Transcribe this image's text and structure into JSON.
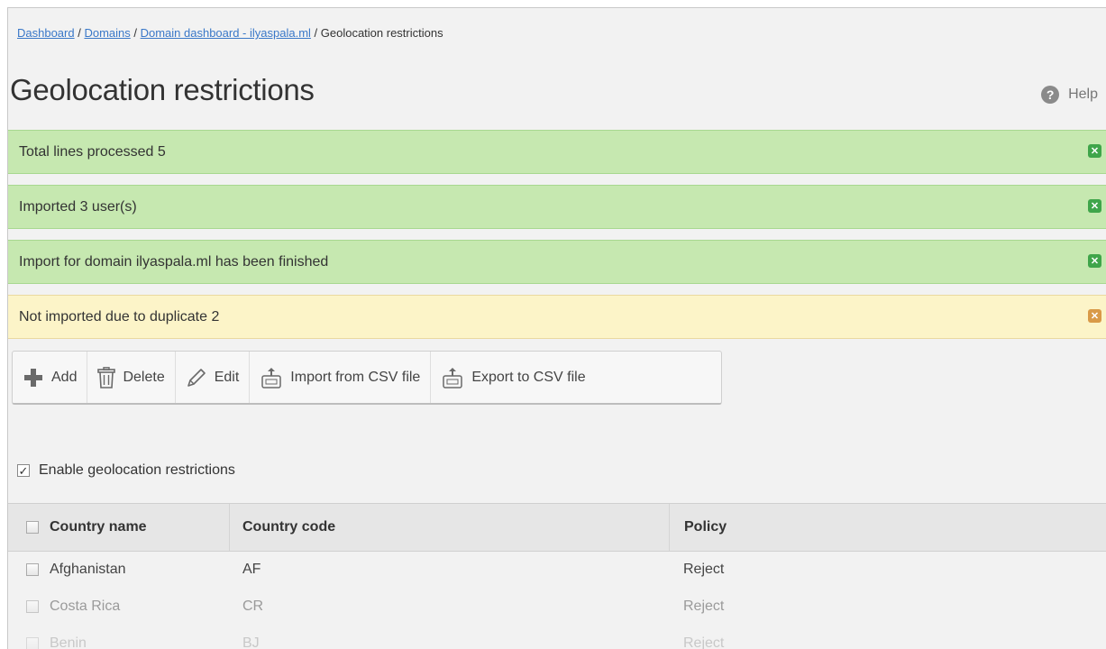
{
  "breadcrumb": {
    "items": [
      "Dashboard",
      "Domains",
      "Domain dashboard - ilyaspala.ml"
    ],
    "separator": " / ",
    "current": "Geolocation restrictions"
  },
  "page": {
    "title": "Geolocation restrictions",
    "help_label": "Help"
  },
  "alerts": [
    {
      "text": "Total lines processed 5",
      "type": "success"
    },
    {
      "text": "Imported 3 user(s)",
      "type": "success"
    },
    {
      "text": "Import for domain ilyaspala.ml has been finished",
      "type": "success"
    },
    {
      "text": "Not imported due to duplicate 2",
      "type": "warning"
    }
  ],
  "toolbar": {
    "add": "Add",
    "delete": "Delete",
    "edit": "Edit",
    "import_csv": "Import from CSV file",
    "export_csv": "Export to CSV file"
  },
  "settings": {
    "enable_label": "Enable geolocation restrictions",
    "enabled": true
  },
  "table": {
    "headers": [
      "Country name",
      "Country code",
      "Policy"
    ],
    "rows": [
      {
        "name": "Afghanistan",
        "code": "AF",
        "policy": "Reject"
      },
      {
        "name": "Costa Rica",
        "code": "CR",
        "policy": "Reject"
      },
      {
        "name": "Benin",
        "code": "BJ",
        "policy": "Reject"
      }
    ]
  },
  "colors": {
    "success_bg": "#c6e8b0",
    "warning_bg": "#fcf4c8",
    "link": "#3a78c8",
    "close_success": "#3fa54a",
    "close_warning": "#d99a48"
  }
}
